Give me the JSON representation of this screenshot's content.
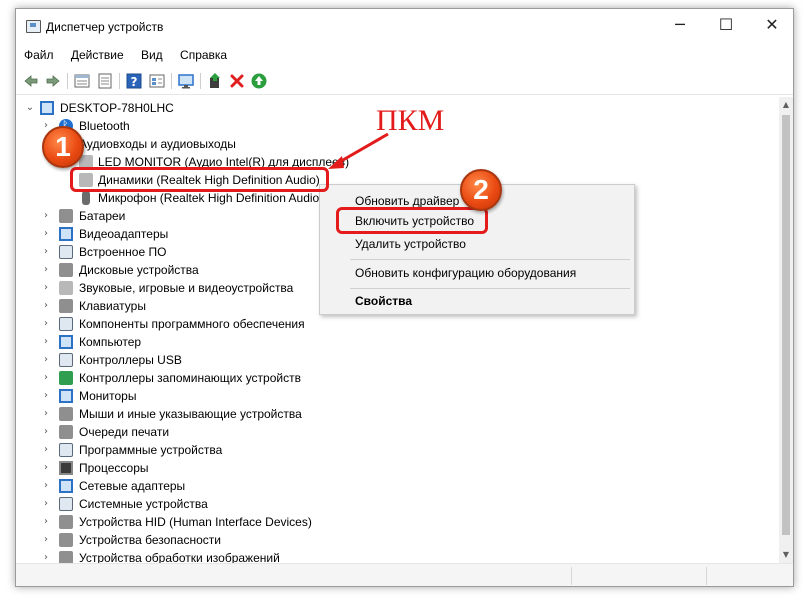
{
  "window": {
    "title": "Диспетчер устройств",
    "controls": {
      "minimize": "─",
      "maximize": "☐",
      "close": "✕"
    }
  },
  "menu": [
    "Файл",
    "Действие",
    "Вид",
    "Справка"
  ],
  "toolbar": {
    "icons": [
      "back-arrow-icon",
      "forward-arrow-icon",
      "properties-icon",
      "list-view-icon",
      "help-icon",
      "list-details-icon",
      "scan-monitor-icon",
      "update-driver-icon",
      "remove-device-icon",
      "enable-device-icon"
    ],
    "colors": {
      "remove": "#e02020",
      "enable": "#2b9e3e"
    }
  },
  "tree": {
    "root": "DESKTOP-78H0LHC",
    "categories": [
      {
        "label": "Bluetooth",
        "icon": "bluetooth-icon"
      },
      {
        "label": "Аудиовходы и аудиовыходы",
        "icon": "audio-icon",
        "expanded": true
      }
    ],
    "audio_children": [
      {
        "label": "LED MONITOR (Аудио Intel(R) для дисплеев)",
        "icon": "speaker-icon"
      },
      {
        "label": "Динамики (Realtek High Definition Audio)",
        "icon": "speaker-disabled-icon",
        "selected": true
      },
      {
        "label": "Микрофон (Realtek High Definition Audio)",
        "icon": "microphone-icon"
      }
    ],
    "rest": [
      {
        "label": "Батареи",
        "icon": "battery-icon"
      },
      {
        "label": "Видеоадаптеры",
        "icon": "display-adapter-icon"
      },
      {
        "label": "Встроенное ПО",
        "icon": "firmware-icon"
      },
      {
        "label": "Дисковые устройства",
        "icon": "disk-icon"
      },
      {
        "label": "Звуковые, игровые и видеоустройства",
        "icon": "sound-icon"
      },
      {
        "label": "Клавиатуры",
        "icon": "keyboard-icon"
      },
      {
        "label": "Компоненты программного обеспечения",
        "icon": "software-component-icon"
      },
      {
        "label": "Компьютер",
        "icon": "computer-icon"
      },
      {
        "label": "Контроллеры USB",
        "icon": "usb-icon"
      },
      {
        "label": "Контроллеры запоминающих устройств",
        "icon": "storage-controller-icon"
      },
      {
        "label": "Мониторы",
        "icon": "monitor-icon"
      },
      {
        "label": "Мыши и иные указывающие устройства",
        "icon": "mouse-icon"
      },
      {
        "label": "Очереди печати",
        "icon": "printer-icon"
      },
      {
        "label": "Программные устройства",
        "icon": "software-device-icon"
      },
      {
        "label": "Процессоры",
        "icon": "processor-icon"
      },
      {
        "label": "Сетевые адаптеры",
        "icon": "network-icon"
      },
      {
        "label": "Системные устройства",
        "icon": "system-device-icon"
      },
      {
        "label": "Устройства HID (Human Interface Devices)",
        "icon": "hid-icon"
      },
      {
        "label": "Устройства безопасности",
        "icon": "security-icon"
      },
      {
        "label": "Устройства обработки изображений",
        "icon": "imaging-icon"
      }
    ]
  },
  "context_menu": {
    "items": [
      {
        "label": "Обновить драйвер"
      },
      {
        "label": "Включить устройство",
        "highlighted": true
      },
      {
        "label": "Удалить устройство"
      },
      {
        "label": "Обновить конфигурацию оборудования"
      },
      {
        "label": "Свойства",
        "bold": true
      }
    ]
  },
  "annotations": {
    "pkm": "ПКМ",
    "step1": "1",
    "step2": "2",
    "color": "#e31b1b"
  }
}
